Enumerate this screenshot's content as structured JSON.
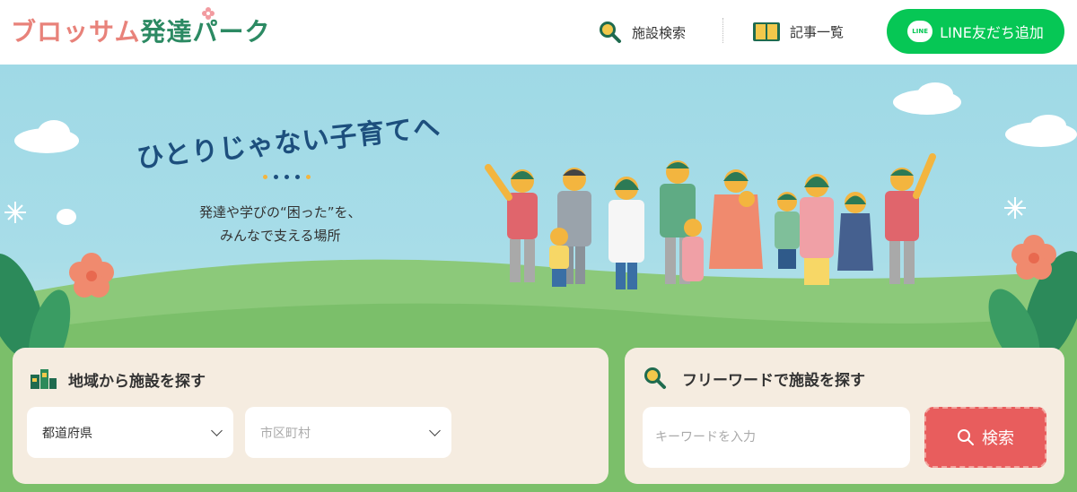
{
  "header": {
    "logo_part1": "ブロッサム",
    "logo_part2": "発達パーク",
    "nav_search_label": "施設検索",
    "nav_articles_label": "記事一覧",
    "line_button_label": "LINE友だち追加",
    "line_icon_text": "LINE"
  },
  "hero": {
    "catchcopy": "ひとりじゃない子育てへ",
    "subcopy_line1": "発達や学びの“困った”を、",
    "subcopy_line2": "みんなで支える場所"
  },
  "area_search": {
    "title": "地域から施設を探す",
    "prefecture_select": "都道府県",
    "city_select_placeholder": "市区町村"
  },
  "keyword_search": {
    "title": "フリーワードで施設を探す",
    "input_placeholder": "キーワードを入力",
    "button_label": "検索"
  },
  "colors": {
    "brand_pink": "#e8827a",
    "brand_green": "#2c8a63",
    "line_green": "#06c755",
    "search_red": "#e85d5d",
    "panel_beige": "#f5ece0",
    "catch_navy": "#1d4f7d"
  },
  "icons": [
    "magnifier-icon",
    "book-icon",
    "line-icon",
    "map-icon",
    "search-icon",
    "chevron-down-icon"
  ]
}
